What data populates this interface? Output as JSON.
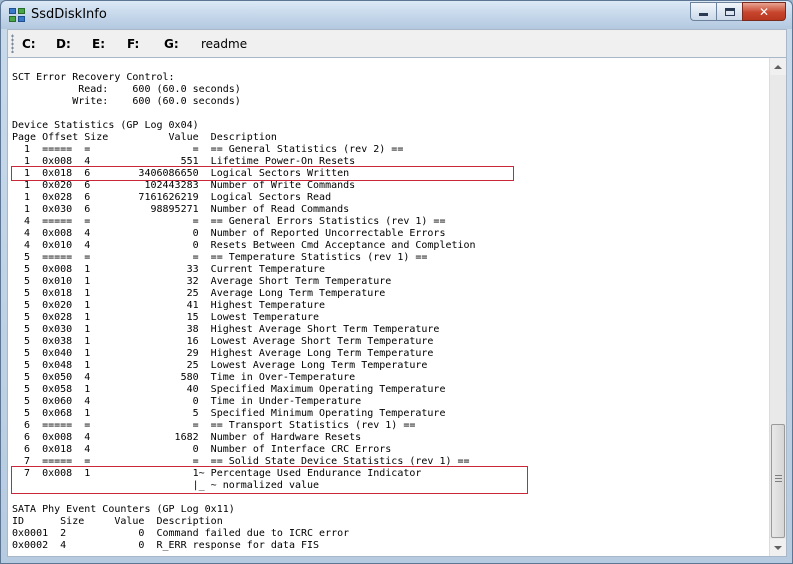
{
  "window": {
    "title": "SsdDiskInfo",
    "controls": {
      "minimize_icon": "minimize-icon",
      "maximize_icon": "maximize-icon",
      "close_label": "✕"
    }
  },
  "toolbar": {
    "items": [
      "C:",
      "D:",
      "E:",
      "F:",
      "G:",
      "readme"
    ]
  },
  "lines": [
    "SCT Error Recovery Control:",
    "           Read:    600 (60.0 seconds)",
    "          Write:    600 (60.0 seconds)",
    "",
    "Device Statistics (GP Log 0x04)",
    "Page Offset Size          Value  Description",
    "  1  =====  =                 =  == General Statistics (rev 2) ==",
    "  1  0x008  4               551  Lifetime Power-On Resets",
    "  1  0x018  6        3406086650  Logical Sectors Written",
    "  1  0x020  6         102443283  Number of Write Commands",
    "  1  0x028  6        7161626219  Logical Sectors Read",
    "  1  0x030  6          98895271  Number of Read Commands",
    "  4  =====  =                 =  == General Errors Statistics (rev 1) ==",
    "  4  0x008  4                 0  Number of Reported Uncorrectable Errors",
    "  4  0x010  4                 0  Resets Between Cmd Acceptance and Completion",
    "  5  =====  =                 =  == Temperature Statistics (rev 1) ==",
    "  5  0x008  1                33  Current Temperature",
    "  5  0x010  1                32  Average Short Term Temperature",
    "  5  0x018  1                25  Average Long Term Temperature",
    "  5  0x020  1                41  Highest Temperature",
    "  5  0x028  1                15  Lowest Temperature",
    "  5  0x030  1                38  Highest Average Short Term Temperature",
    "  5  0x038  1                16  Lowest Average Short Term Temperature",
    "  5  0x040  1                29  Highest Average Long Term Temperature",
    "  5  0x048  1                25  Lowest Average Long Term Temperature",
    "  5  0x050  4               580  Time in Over-Temperature",
    "  5  0x058  1                40  Specified Maximum Operating Temperature",
    "  5  0x060  4                 0  Time in Under-Temperature",
    "  5  0x068  1                 5  Specified Minimum Operating Temperature",
    "  6  =====  =                 =  == Transport Statistics (rev 1) ==",
    "  6  0x008  4              1682  Number of Hardware Resets",
    "  6  0x018  4                 0  Number of Interface CRC Errors",
    "  7  =====  =                 =  == Solid State Device Statistics (rev 1) ==",
    "  7  0x008  1                 1~ Percentage Used Endurance Indicator",
    "                              |_ ~ normalized value",
    "",
    "SATA Phy Event Counters (GP Log 0x11)",
    "ID      Size     Value  Description",
    "0x0001  2            0  Command failed due to ICRC error",
    "0x0002  4            0  R_ERR response for data FIS"
  ]
}
